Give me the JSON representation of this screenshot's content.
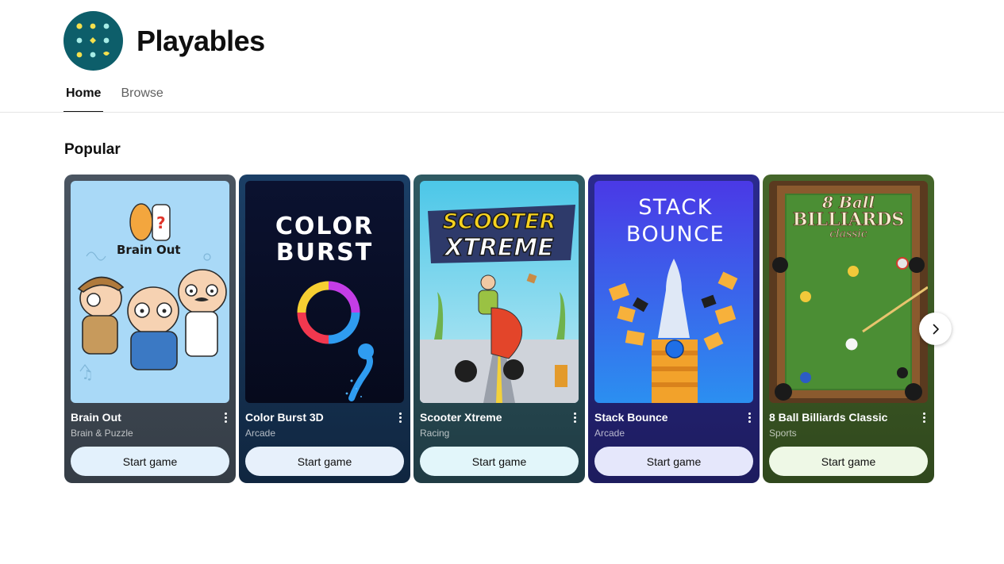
{
  "app": {
    "title": "Playables"
  },
  "tabs": [
    {
      "label": "Home",
      "active": true
    },
    {
      "label": "Browse",
      "active": false
    }
  ],
  "section": {
    "title": "Popular"
  },
  "games": [
    {
      "name": "Brain Out",
      "genre": "Brain & Puzzle",
      "button": "Start game",
      "thumb_text": "Brain Out",
      "card_color": "#3f4a54",
      "button_color": "#e3f1fc"
    },
    {
      "name": "Color Burst 3D",
      "genre": "Arcade",
      "button": "Start game",
      "thumb_text": [
        "COLOR",
        "BURST"
      ],
      "card_color": "#163557",
      "button_color": "#e7f0fb"
    },
    {
      "name": "Scooter Xtreme",
      "genre": "Racing",
      "button": "Start game",
      "thumb_text": [
        "SCOOTER",
        "XTREME"
      ],
      "card_color": "#2b4d55",
      "button_color": "#e2f6fa"
    },
    {
      "name": "Stack Bounce",
      "genre": "Arcade",
      "button": "Start game",
      "thumb_text": [
        "STACK",
        "BOUNCE"
      ],
      "card_color": "#27267a",
      "button_color": "#e5e7fb"
    },
    {
      "name": "8 Ball Billiards Classic",
      "genre": "Sports",
      "button": "Start game",
      "thumb_text": [
        "8 Ball",
        "BILLIARDS",
        "classic"
      ],
      "card_color": "#3e5a27",
      "button_color": "#eef8e6"
    }
  ],
  "icons": {
    "logo": "playables-logo-icon",
    "more": "more-vert-icon",
    "next": "chevron-right-icon"
  },
  "colors": {
    "logo_bg": "#0d5e6a",
    "logo_dots": "#f4e04d",
    "accent": "#0f0f0f"
  }
}
